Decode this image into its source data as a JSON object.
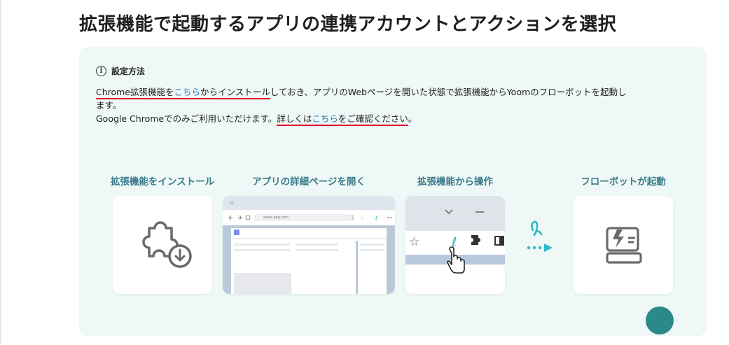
{
  "page": {
    "title": "拡張機能で起動するアプリの連携アカウントとアクションを選択"
  },
  "info": {
    "icon": "info-icon",
    "title": "設定方法",
    "line1": {
      "hl_prefix": "Chrome拡張機能を",
      "link": "こちら",
      "hl_suffix": "からインストール",
      "rest": "しておき、アプリのWebページを開いた状態で拡張機能からYoomのフローボットを起動し"
    },
    "line2": "ます。",
    "line3": {
      "text": "Google Chromeでのみご利用いただけます。",
      "hl_prefix": "詳しくは",
      "link": "こちら",
      "hl_suffix": "をご確認ください",
      "end": "。"
    }
  },
  "steps": [
    {
      "title": "拡張機能をインストール",
      "icon": "puzzle-download-icon"
    },
    {
      "title": "アプリの詳細ページを開く",
      "icon": "browser-page-icon",
      "url": "sales.app.com"
    },
    {
      "title": "拡張機能から操作",
      "icon": "extension-toolbar-icon"
    },
    {
      "title": "フローボットが起動",
      "icon": "flowbot-launch-icon"
    }
  ],
  "colors": {
    "accent": "#2fb8c4",
    "step_title": "#3b7b8c",
    "link": "#2a7cb8",
    "underline": "#e0132f",
    "panel_bg": "#eef8f6"
  }
}
